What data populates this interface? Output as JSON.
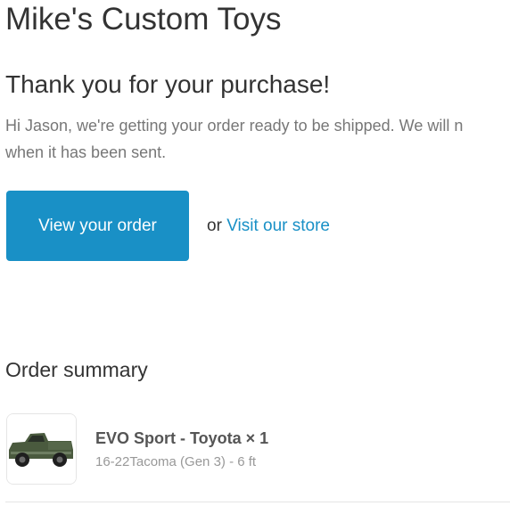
{
  "header": {
    "shop_name": "Mike's Custom Toys"
  },
  "message": {
    "title": "Thank you for your purchase!",
    "line1": "Hi Jason, we're getting your order ready to be shipped. We will n",
    "line2": "when it has been sent."
  },
  "actions": {
    "view_order_label": "View your order",
    "or_text": "or",
    "visit_store_label": "Visit our store"
  },
  "summary": {
    "title": "Order summary",
    "items": [
      {
        "title": "EVO Sport - Toyota × 1",
        "variant": "16-22Tacoma (Gen 3) - 6 ft",
        "image_icon": "truck-product-image"
      }
    ]
  },
  "colors": {
    "accent": "#1990c6",
    "text": "#333333",
    "muted": "#777777"
  }
}
